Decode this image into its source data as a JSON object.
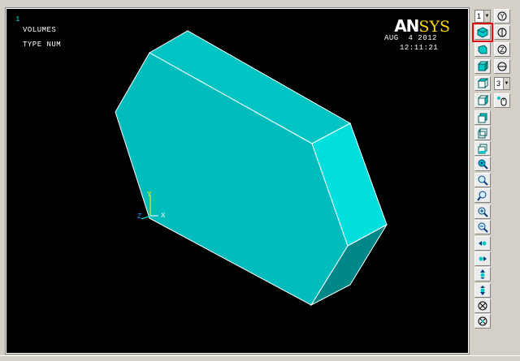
{
  "viewport": {
    "window_number": "1",
    "lines": [
      "VOLUMES",
      "TYPE NUM"
    ],
    "logo_an": "AN",
    "logo_sys": "SYS",
    "date": "AUG  4 2012",
    "time": "12:11:21",
    "triad": {
      "y_label": "Y",
      "x_label": "X",
      "z_label": "Z"
    },
    "colors": {
      "background": "#000000",
      "face_main": "#00bcbc",
      "face_top": "#00c4c4",
      "face_right": "#00dede",
      "face_bottom": "#008787",
      "edge": "#ffffff",
      "logo_accent": "#ffd700"
    }
  },
  "toolbar": {
    "window_select": "1",
    "angle_select": "3",
    "buttons": [
      "fit-view-icon",
      "isometric-view-icon",
      "front-view-icon",
      "top-view-icon",
      "right-view-icon",
      "back-view-icon",
      "left-view-icon",
      "bottom-view-icon",
      "zoom-icon",
      "box-zoom-icon",
      "win-zoom-icon",
      "zoom-in-icon",
      "zoom-out-icon",
      "rotate-x-neg-icon",
      "rotate-x-pos-icon",
      "rotate-y-neg-icon",
      "rotate-y-pos-icon",
      "rotate-z-neg-icon",
      "rotate-z-pos-icon",
      "dynamic-mode-icon",
      "pan-zoom-rotate-icon",
      "rotate-left-icon",
      "rotate-right-icon",
      "mouse-icon"
    ]
  }
}
